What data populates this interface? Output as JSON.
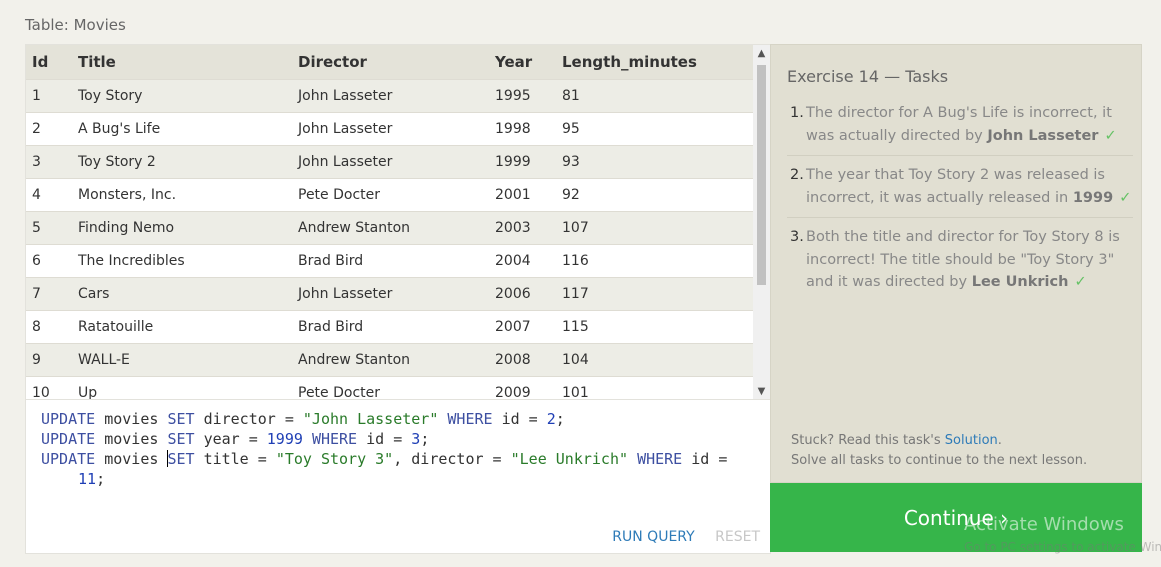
{
  "table_caption": "Table: Movies",
  "table": {
    "columns": [
      "Id",
      "Title",
      "Director",
      "Year",
      "Length_minutes"
    ],
    "rows": [
      [
        "1",
        "Toy Story",
        "John Lasseter",
        "1995",
        "81"
      ],
      [
        "2",
        "A Bug's Life",
        "John Lasseter",
        "1998",
        "95"
      ],
      [
        "3",
        "Toy Story 2",
        "John Lasseter",
        "1999",
        "93"
      ],
      [
        "4",
        "Monsters, Inc.",
        "Pete Docter",
        "2001",
        "92"
      ],
      [
        "5",
        "Finding Nemo",
        "Andrew Stanton",
        "2003",
        "107"
      ],
      [
        "6",
        "The Incredibles",
        "Brad Bird",
        "2004",
        "116"
      ],
      [
        "7",
        "Cars",
        "John Lasseter",
        "2006",
        "117"
      ],
      [
        "8",
        "Ratatouille",
        "Brad Bird",
        "2007",
        "115"
      ],
      [
        "9",
        "WALL-E",
        "Andrew Stanton",
        "2008",
        "104"
      ],
      [
        "10",
        "Up",
        "Pete Docter",
        "2009",
        "101"
      ]
    ]
  },
  "scrollbar": {
    "up_icon": "▲",
    "down_icon": "▼"
  },
  "editor": {
    "lines": [
      [
        [
          "kw",
          "UPDATE"
        ],
        [
          "",
          "movies"
        ],
        [
          "kw",
          "SET"
        ],
        [
          "",
          "director ="
        ],
        [
          "str",
          "\"John Lasseter\""
        ],
        [
          "kw",
          "WHERE"
        ],
        [
          "",
          "id ="
        ],
        [
          "num",
          "2"
        ],
        [
          "",
          ";"
        ]
      ],
      [
        [
          "kw",
          "UPDATE"
        ],
        [
          "",
          "movies"
        ],
        [
          "kw",
          "SET"
        ],
        [
          "",
          "year ="
        ],
        [
          "num",
          "1999"
        ],
        [
          "kw",
          "WHERE"
        ],
        [
          "",
          "id ="
        ],
        [
          "num",
          "3"
        ],
        [
          "",
          ";"
        ]
      ],
      [
        [
          "kw",
          "UPDATE"
        ],
        [
          "",
          "movies"
        ],
        [
          "kw",
          "SET"
        ],
        [
          "",
          "title ="
        ],
        [
          "str",
          "\"Toy Story 3\""
        ],
        [
          "",
          ", director ="
        ],
        [
          "str",
          "\"Lee Unkrich\""
        ],
        [
          "kw",
          "WHERE"
        ],
        [
          "",
          "id ="
        ]
      ],
      [
        [
          "num",
          "11"
        ],
        [
          "",
          ";"
        ]
      ]
    ],
    "run_label": "RUN QUERY",
    "reset_label": "RESET"
  },
  "tasks": {
    "heading": "Exercise 14 — Tasks",
    "items": [
      {
        "num": "1.",
        "text": "The director for A Bug's Life is incorrect, it was actually directed by ",
        "strong": "John Lasseter",
        "check": "✓"
      },
      {
        "num": "2.",
        "text": "The year that Toy Story 2 was released is incorrect, it was actually released in ",
        "strong": "1999",
        "check": "✓"
      },
      {
        "num": "3.",
        "text": "Both the title and director for Toy Story 8 is incorrect! The title should be \"Toy Story 3\" and it was directed by ",
        "strong": "Lee Unkrich",
        "check": "✓"
      }
    ],
    "stuck_prefix": "Stuck? Read this task's ",
    "solution_link": "Solution",
    "stuck_suffix": ".",
    "stuck_line2": "Solve all tasks to continue to the next lesson."
  },
  "continue_label": "Continue ›",
  "watermark": {
    "title": "Activate Windows",
    "sub": "Go to PC settings to activate Windows."
  }
}
